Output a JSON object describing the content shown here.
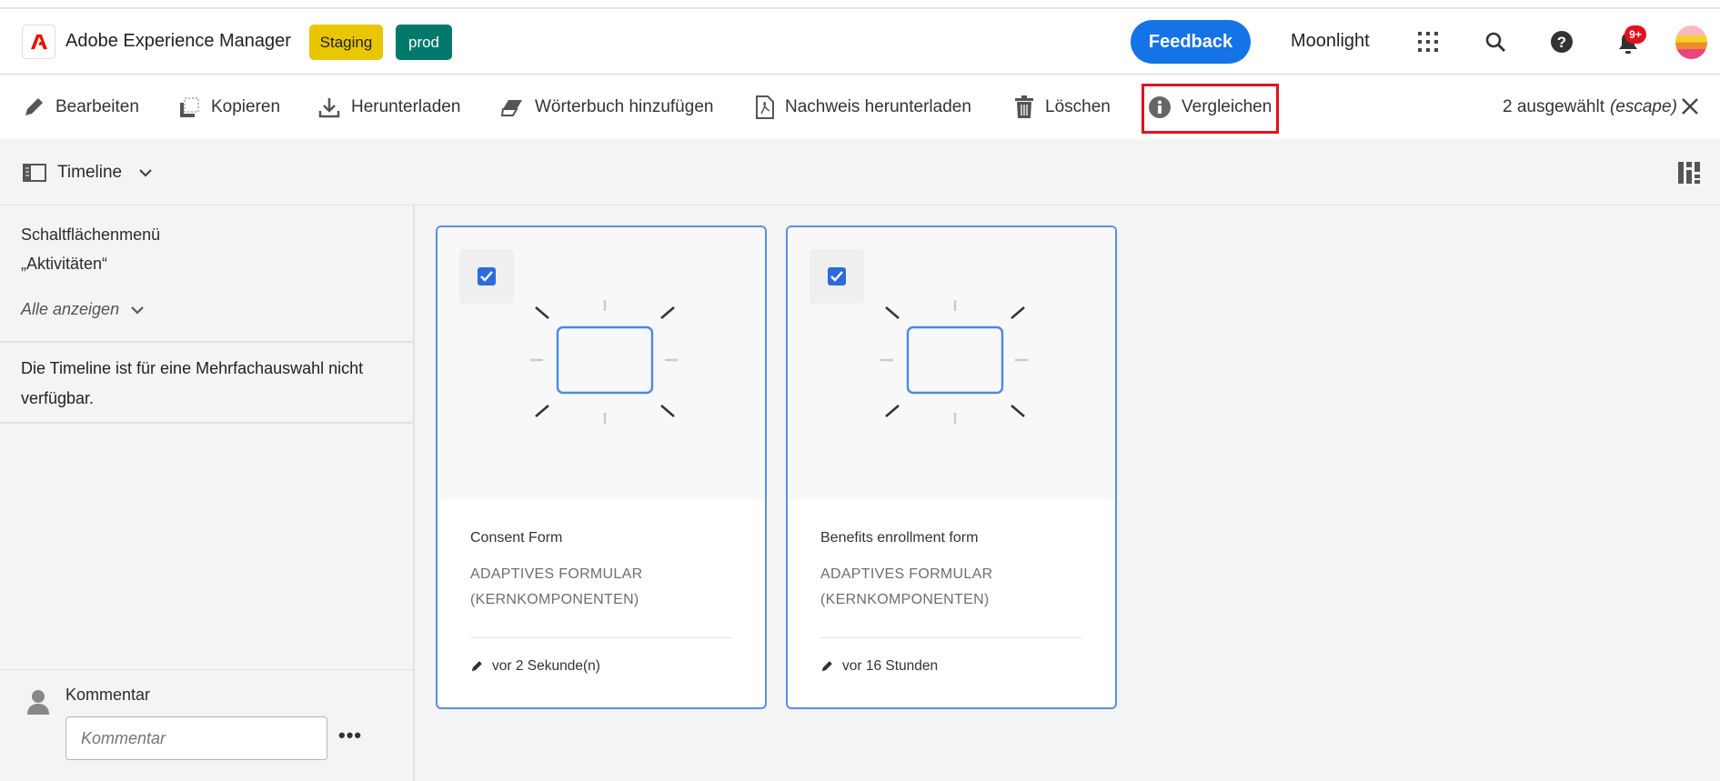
{
  "header": {
    "app_title": "Adobe Experience Manager",
    "badges": [
      {
        "label": "Staging",
        "color": "#e8c600"
      },
      {
        "label": "prod",
        "color": "#00796b"
      }
    ],
    "feedback_label": "Feedback",
    "org_name": "Moonlight",
    "notification_count": "9+",
    "icons": [
      "apps-grid-icon",
      "search-icon",
      "help-icon",
      "bell-icon",
      "avatar"
    ]
  },
  "toolbar": {
    "items": [
      {
        "label": "Bearbeiten",
        "icon": "pencil-icon"
      },
      {
        "label": "Kopieren",
        "icon": "copy-icon"
      },
      {
        "label": "Herunterladen",
        "icon": "download-icon"
      },
      {
        "label": "Wörterbuch hinzufügen",
        "icon": "eraser-icon"
      },
      {
        "label": "Nachweis herunterladen",
        "icon": "pdf-file-icon"
      },
      {
        "label": "Löschen",
        "icon": "trash-icon"
      },
      {
        "label": "Vergleichen",
        "icon": "info-icon",
        "highlighted": true
      }
    ],
    "selection_count": "2 ausgewählt",
    "selection_hint": "(escape)"
  },
  "rail": {
    "view_label": "Timeline"
  },
  "sidebar": {
    "menu_title_line1": "Schaltflächenmenü",
    "menu_title_line2": "„Aktivitäten“",
    "show_all": "Alle anzeigen",
    "message_line1": "Die Timeline ist für eine Mehrfachauswahl nicht",
    "message_line2": "verfügbar.",
    "comment_label": "Kommentar",
    "comment_placeholder": "Kommentar"
  },
  "cards": [
    {
      "title": "Consent Form",
      "type_line1": "ADAPTIVES FORMULAR",
      "type_line2": "(KERNKOMPONENTEN)",
      "modified": "vor 2 Sekunde(n)",
      "selected": true
    },
    {
      "title": "Benefits enrollment form",
      "type_line1": "ADAPTIVES FORMULAR",
      "type_line2": "(KERNKOMPONENTEN)",
      "modified": "vor 16 Stunden",
      "selected": true
    }
  ],
  "colors": {
    "accent": "#1473e6",
    "selection_border": "#5a8fe6",
    "highlight": "#e3101e",
    "notification": "#e3101e"
  }
}
